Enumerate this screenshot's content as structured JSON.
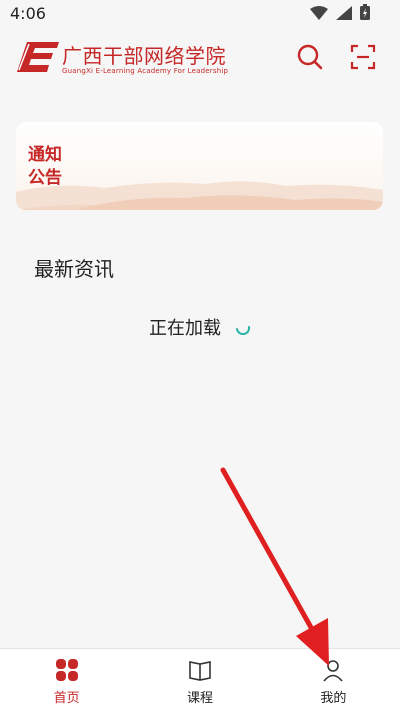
{
  "status_bar": {
    "time": "4:06"
  },
  "header": {
    "title_cn": "广西干部网络学院",
    "title_en": "GuangXi E-Learning Academy For Leadership"
  },
  "notice": {
    "title": "通知\n公告"
  },
  "news": {
    "section_title": "最新资讯",
    "loading_text": "正在加载"
  },
  "tabbar": {
    "tabs": [
      {
        "label": "首页",
        "icon": "home-grid-icon",
        "active": true
      },
      {
        "label": "课程",
        "icon": "book-icon",
        "active": false
      },
      {
        "label": "我的",
        "icon": "person-icon",
        "active": false
      }
    ]
  },
  "colors": {
    "brand": "#c62828",
    "accent_teal": "#26b3a3",
    "annotation_red": "#e02020"
  }
}
